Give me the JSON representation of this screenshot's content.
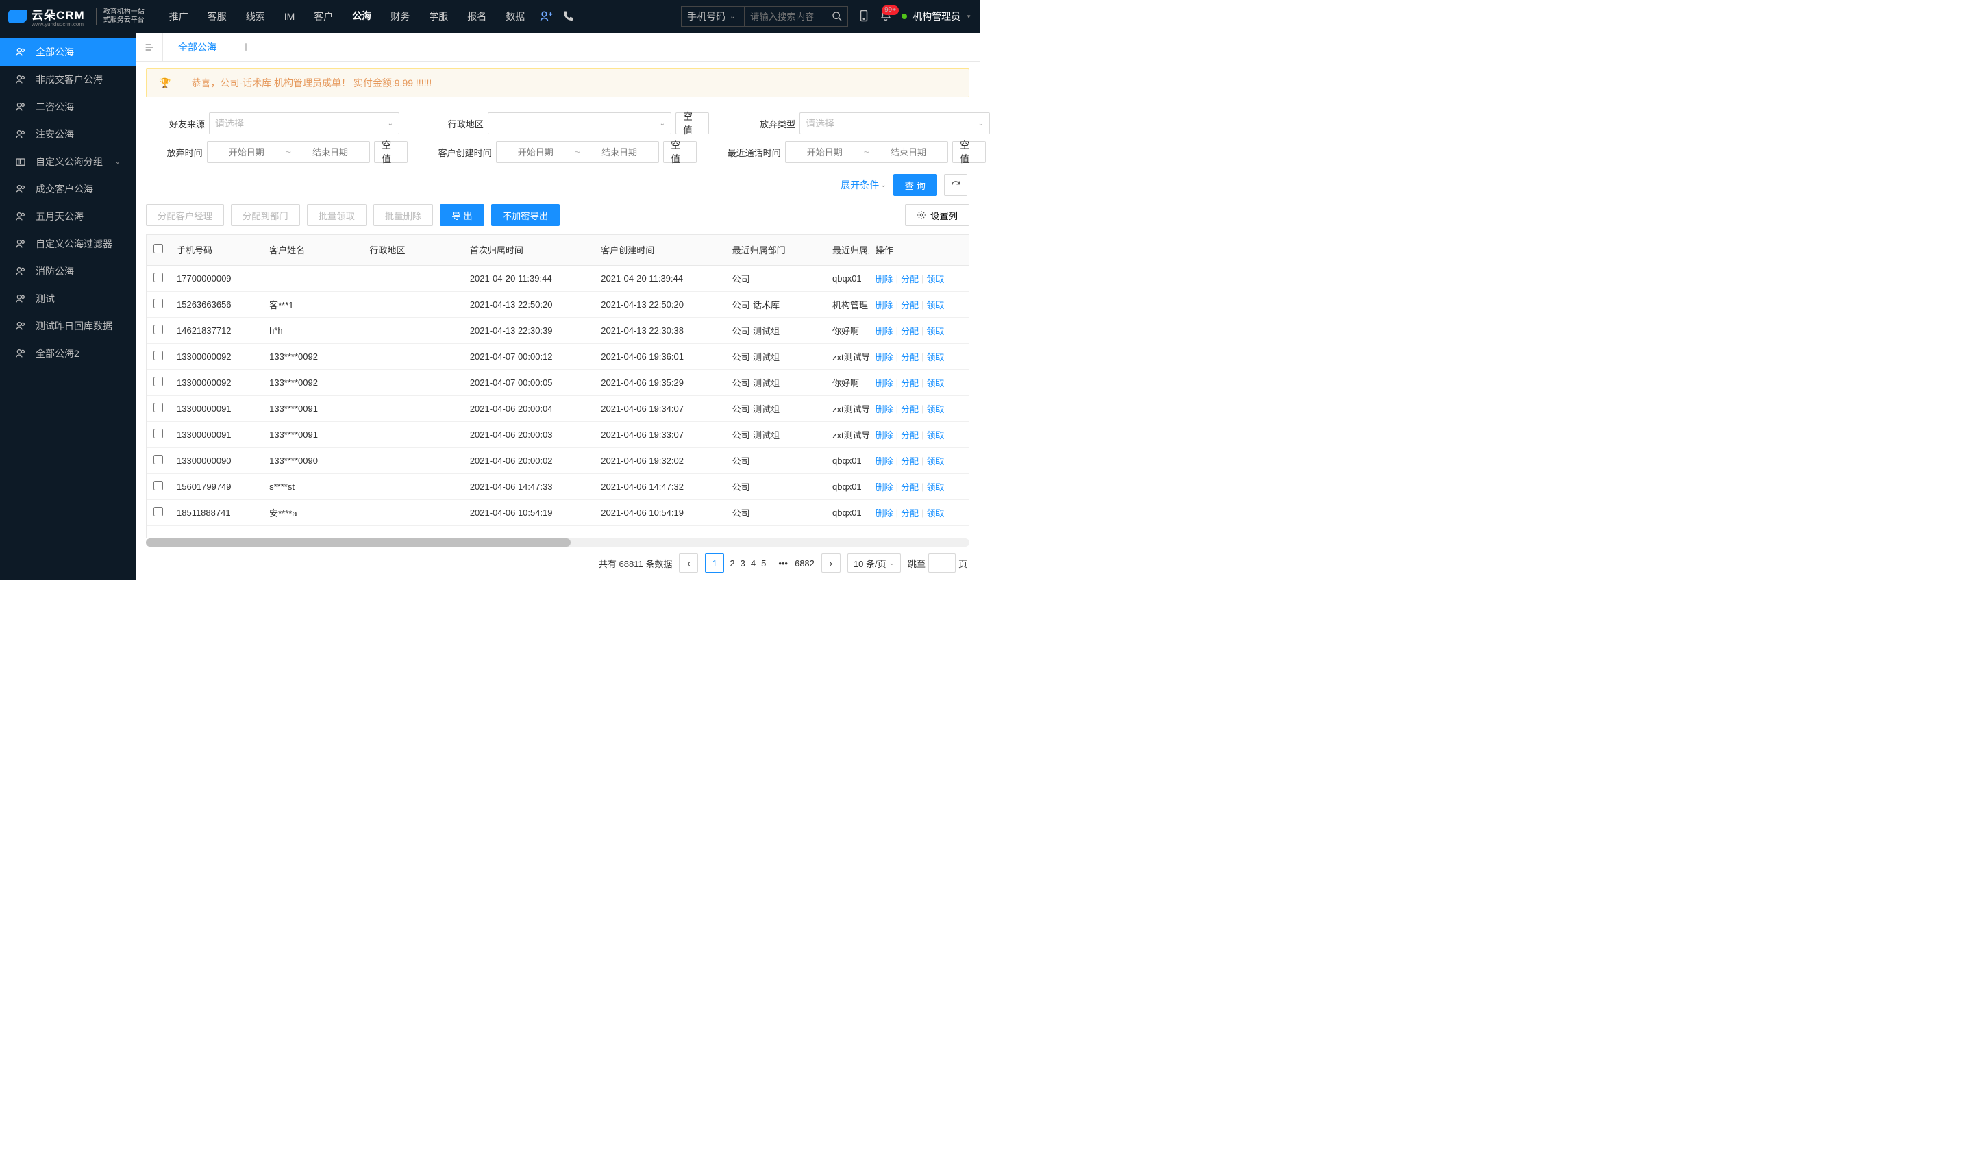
{
  "brand": {
    "name": "云朵CRM",
    "sub1": "教育机构一站",
    "sub2": "式服务云平台",
    "url": "www.yunduocrm.com"
  },
  "top_nav": [
    "推广",
    "客服",
    "线索",
    "IM",
    "客户",
    "公海",
    "财务",
    "学服",
    "报名",
    "数据"
  ],
  "top_nav_active_index": 5,
  "search": {
    "type": "手机号码",
    "placeholder": "请输入搜索内容"
  },
  "header": {
    "badge": "99+",
    "user": "机构管理员"
  },
  "sidebar": [
    {
      "label": "全部公海",
      "icon": "all"
    },
    {
      "label": "非成交客户公海",
      "icon": "user"
    },
    {
      "label": "二咨公海",
      "icon": "user"
    },
    {
      "label": "注安公海",
      "icon": "user"
    },
    {
      "label": "自定义公海分组",
      "icon": "folder",
      "expandable": true
    },
    {
      "label": "成交客户公海",
      "icon": "user"
    },
    {
      "label": "五月天公海",
      "icon": "user"
    },
    {
      "label": "自定义公海过滤器",
      "icon": "user"
    },
    {
      "label": "消防公海",
      "icon": "user"
    },
    {
      "label": "测试",
      "icon": "user"
    },
    {
      "label": "测试昨日回库数据",
      "icon": "user"
    },
    {
      "label": "全部公海2",
      "icon": "user"
    }
  ],
  "sidebar_active_index": 0,
  "tabs": {
    "current": "全部公海"
  },
  "banner": "恭喜，公司-话术库  机构管理员成单！  实付金额:9.99 !!!!!!",
  "filters": {
    "row1": [
      {
        "label": "好友来源",
        "type": "select",
        "placeholder": "请选择"
      },
      {
        "label": "行政地区",
        "type": "select",
        "placeholder": "",
        "null_btn": "空值"
      },
      {
        "label": "放弃类型",
        "type": "select",
        "placeholder": "请选择"
      }
    ],
    "row2": [
      {
        "label": "放弃时间",
        "type": "range",
        "ph_start": "开始日期",
        "ph_end": "结束日期",
        "null_btn": "空值"
      },
      {
        "label": "客户创建时间",
        "type": "range",
        "ph_start": "开始日期",
        "ph_end": "结束日期",
        "null_btn": "空值"
      },
      {
        "label": "最近通话时间",
        "type": "range",
        "ph_start": "开始日期",
        "ph_end": "结束日期",
        "null_btn": "空值"
      }
    ],
    "expand": "展开条件",
    "query": "查 询"
  },
  "toolbar": {
    "btns_left": [
      "分配客户经理",
      "分配到部门",
      "批量领取",
      "批量删除"
    ],
    "btns_primary": [
      "导 出",
      "不加密导出"
    ],
    "settings": "设置列"
  },
  "columns": [
    "手机号码",
    "客户姓名",
    "行政地区",
    "首次归属时间",
    "客户创建时间",
    "最近归属部门",
    "最近归属人",
    "操作"
  ],
  "ops": {
    "delete": "删除",
    "assign": "分配",
    "claim": "领取"
  },
  "rows": [
    {
      "phone": "17700000009",
      "name": "",
      "region": "",
      "first": "2021-04-20 11:39:44",
      "created": "2021-04-20 11:39:44",
      "dept": "公司",
      "owner": "qbqx01"
    },
    {
      "phone": "15263663656",
      "name": "客***1",
      "region": "",
      "first": "2021-04-13 22:50:20",
      "created": "2021-04-13 22:50:20",
      "dept": "公司-话术库",
      "owner": "机构管理员"
    },
    {
      "phone": "14621837712",
      "name": "h*h",
      "region": "",
      "first": "2021-04-13 22:30:39",
      "created": "2021-04-13 22:30:38",
      "dept": "公司-测试组",
      "owner": "你好啊"
    },
    {
      "phone": "13300000092",
      "name": "133****0092",
      "region": "",
      "first": "2021-04-07 00:00:12",
      "created": "2021-04-06 19:36:01",
      "dept": "公司-测试组",
      "owner": "zxt测试导入"
    },
    {
      "phone": "13300000092",
      "name": "133****0092",
      "region": "",
      "first": "2021-04-07 00:00:05",
      "created": "2021-04-06 19:35:29",
      "dept": "公司-测试组",
      "owner": "你好啊"
    },
    {
      "phone": "13300000091",
      "name": "133****0091",
      "region": "",
      "first": "2021-04-06 20:00:04",
      "created": "2021-04-06 19:34:07",
      "dept": "公司-测试组",
      "owner": "zxt测试导入"
    },
    {
      "phone": "13300000091",
      "name": "133****0091",
      "region": "",
      "first": "2021-04-06 20:00:03",
      "created": "2021-04-06 19:33:07",
      "dept": "公司-测试组",
      "owner": "zxt测试导入"
    },
    {
      "phone": "13300000090",
      "name": "133****0090",
      "region": "",
      "first": "2021-04-06 20:00:02",
      "created": "2021-04-06 19:32:02",
      "dept": "公司",
      "owner": "qbqx01"
    },
    {
      "phone": "15601799749",
      "name": "s****st",
      "region": "",
      "first": "2021-04-06 14:47:33",
      "created": "2021-04-06 14:47:32",
      "dept": "公司",
      "owner": "qbqx01"
    },
    {
      "phone": "18511888741",
      "name": "安****a",
      "region": "",
      "first": "2021-04-06 10:54:19",
      "created": "2021-04-06 10:54:19",
      "dept": "公司",
      "owner": "qbqx01"
    }
  ],
  "pager": {
    "total_text": "共有",
    "total": 68811,
    "total_suffix": "条数据",
    "pages": [
      "1",
      "2",
      "3",
      "4",
      "5"
    ],
    "last": "6882",
    "size": "10 条/页",
    "jump_l": "跳至",
    "jump_r": "页"
  }
}
